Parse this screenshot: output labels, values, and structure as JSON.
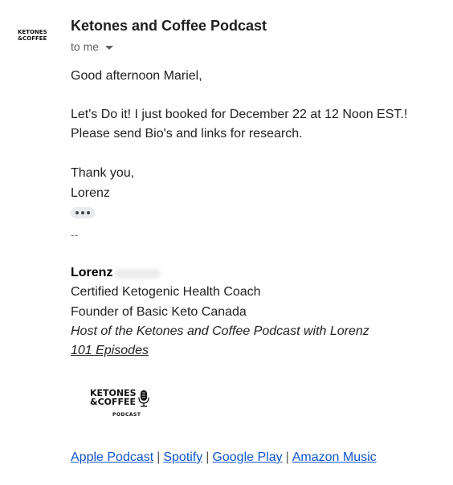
{
  "email": {
    "avatar_text_1": "KETONES",
    "avatar_text_2": "&COFFEE",
    "sender_name": "Ketones and Coffee Podcast",
    "recipient_label": "to me",
    "greeting": "Good afternoon Mariel,",
    "line1": "Let's Do it! I just booked for December 22 at 12 Noon EST.!",
    "line2": "Please send Bio's and links for research.",
    "thanks": "Thank you,",
    "sign_name": "Lorenz",
    "signature_separator": "--",
    "signature": {
      "name": "Lorenz",
      "title": "Certified Ketogenic Health Coach",
      "founder": "Founder of Basic Keto Canada",
      "host": "Host of the Ketones and Coffee Podcast with Lorenz",
      "episodes": "101 Episodes",
      "logo_line1": "KETONES",
      "logo_line2": "&COFFEE",
      "logo_sub": "PODCAST"
    },
    "links": [
      {
        "label": "Apple Podcast"
      },
      {
        "label": "Spotify"
      },
      {
        "label": "Google Play"
      },
      {
        "label": "Amazon Music"
      }
    ],
    "link_separator": "|"
  }
}
